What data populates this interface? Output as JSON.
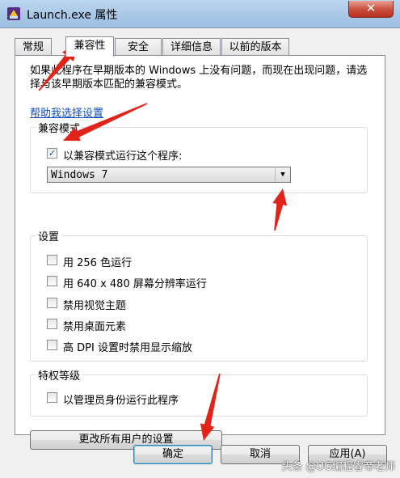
{
  "window": {
    "title": "Launch.exe 属性",
    "close": "✕"
  },
  "tabs": [
    {
      "label": "常规"
    },
    {
      "label": "兼容性"
    },
    {
      "label": "安全"
    },
    {
      "label": "详细信息"
    },
    {
      "label": "以前的版本"
    }
  ],
  "description": "如果此程序在早期版本的 Windows 上没有问题，而现在出现问题，请选择与该早期版本匹配的兼容模式。",
  "help_link": "帮助我选择设置",
  "compat_group": {
    "label": "兼容模式",
    "checkbox": {
      "label": "以兼容模式运行这个程序:",
      "checked": true
    },
    "select": {
      "value": "Windows 7"
    }
  },
  "settings_group": {
    "label": "设置",
    "items": [
      {
        "label": "用 256 色运行",
        "checked": false
      },
      {
        "label": "用 640 x 480 屏幕分辨率运行",
        "checked": false
      },
      {
        "label": "禁用视觉主题",
        "checked": false
      },
      {
        "label": "禁用桌面元素",
        "checked": false
      },
      {
        "label": "高 DPI 设置时禁用显示缩放",
        "checked": false
      }
    ]
  },
  "privilege_group": {
    "label": "特权等级",
    "checkbox": {
      "label": "以管理员身份运行此程序",
      "checked": false
    }
  },
  "all_users_button": "更改所有用户的设置",
  "buttons": {
    "ok": "确定",
    "cancel": "取消",
    "apply": "应用(A)"
  },
  "watermark": "头条 @UG编程睿帝老师",
  "colors": {
    "annotation_arrow": "#e2231a",
    "link": "#0f4ec2"
  },
  "icons": {
    "app": "app-icon",
    "check": "checkmark-icon",
    "dropdown": "chevron-down-icon"
  }
}
